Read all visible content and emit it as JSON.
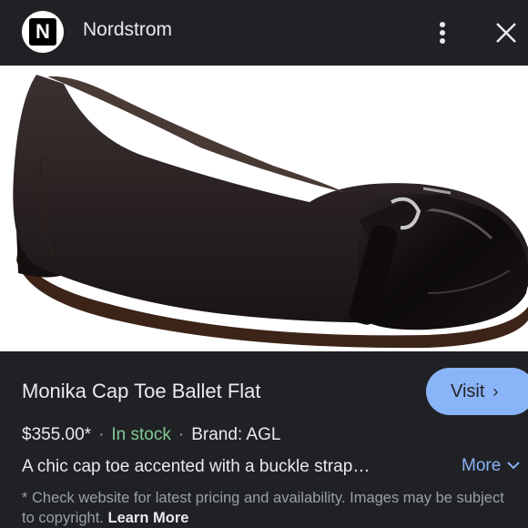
{
  "header": {
    "logo_letter": "N",
    "site_name": "Nordstrom"
  },
  "product": {
    "title": "Monika Cap Toe Ballet Flat",
    "visit_label": "Visit",
    "price": "$355.00*",
    "stock": "In stock",
    "brand": "Brand: AGL",
    "description": "A chic cap toe accented with a buckle strap…",
    "more_label": "More",
    "disclaimer": "* Check website for latest pricing and availability. Images may be subject to copyright.",
    "learn_more": "Learn More"
  },
  "colors": {
    "background": "#202124",
    "accent": "#8ab4f8",
    "stock_green": "#81c995"
  },
  "icons": [
    "more-vert-icon",
    "close-icon",
    "chevron-right-icon",
    "chevron-down-icon"
  ]
}
